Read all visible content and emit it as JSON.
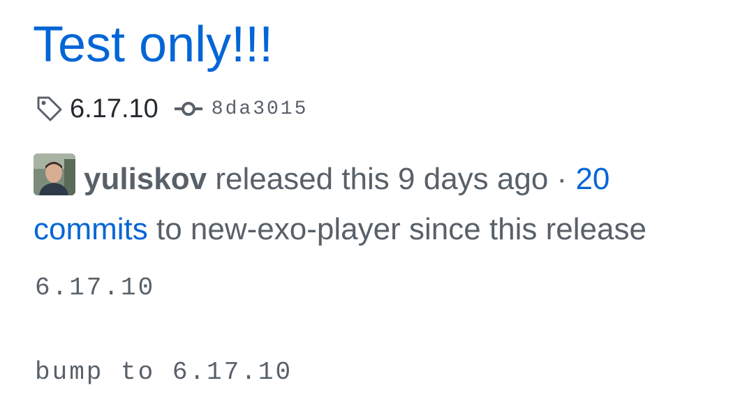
{
  "release": {
    "title": "Test only!!!",
    "tag_name": "6.17.10",
    "commit_sha": "8da3015",
    "author": "yuliskov",
    "released_text": "released this 9 days ago",
    "separator": "·",
    "commits_link": "20 commits",
    "commits_suffix": "to new-exo-player since this release",
    "body_lines": [
      "6.17.10",
      "bump to 6.17.10"
    ]
  },
  "icons": {
    "tag": "tag-icon",
    "commit": "git-commit-icon",
    "avatar": "user-avatar"
  },
  "colors": {
    "link": "#0366d6",
    "text": "#586069",
    "text_dark": "#24292e",
    "icon": "#586069"
  }
}
